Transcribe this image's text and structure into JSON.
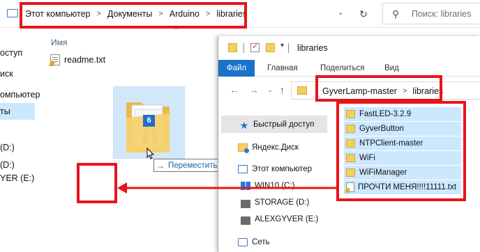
{
  "back_window": {
    "breadcrumbs": [
      "Этот компьютер",
      "Документы",
      "Arduino",
      "libraries"
    ],
    "search_placeholder": "Поиск: libraries",
    "sidebar_items": [
      "оступ",
      "иск",
      "омпьютер",
      "ты",
      "(D:)",
      "(D:)",
      "YER (E:)"
    ],
    "column_header": "Имя",
    "files": [
      {
        "name": "readme.txt",
        "icon": "text-file-icon"
      }
    ],
    "drag_badge_count": "6",
    "drag_tooltip": "Переместить в \"libraries\""
  },
  "front_window": {
    "title": "libraries",
    "ribbon_tabs": [
      "Файл",
      "Главная",
      "Поделиться",
      "Вид"
    ],
    "breadcrumbs": [
      "GyverLamp-master",
      "libraries"
    ],
    "nav_tree": [
      {
        "label": "Быстрый доступ",
        "icon": "star-icon",
        "selected": true
      },
      {
        "label": "Яндекс.Диск",
        "icon": "yandex-disk-icon",
        "selected": false
      },
      {
        "label": "Этот компьютер",
        "icon": "computer-icon",
        "selected": false
      },
      {
        "label": "WIN10 (C:)",
        "icon": "windows-drive-icon",
        "selected": false
      },
      {
        "label": "STORAGE (D:)",
        "icon": "drive-icon",
        "selected": false
      },
      {
        "label": "ALEXGYVER (E:)",
        "icon": "drive-icon",
        "selected": false
      },
      {
        "label": "Сеть",
        "icon": "network-icon",
        "selected": false
      }
    ],
    "files": [
      {
        "name": "FastLED-3.2.9",
        "icon": "folder-icon",
        "selected": true
      },
      {
        "name": "GyverButton",
        "icon": "folder-icon",
        "selected": true
      },
      {
        "name": "NTPClient-master",
        "icon": "folder-icon",
        "selected": true
      },
      {
        "name": "WiFi",
        "icon": "folder-icon",
        "selected": true
      },
      {
        "name": "WiFiManager",
        "icon": "folder-icon",
        "selected": true
      },
      {
        "name": "ПРОЧТИ МЕНЯ!!!!11111.txt",
        "icon": "text-file-icon",
        "selected": true
      }
    ]
  },
  "colors": {
    "annotation_red": "#e8141c",
    "selection_blue": "#cce8ff",
    "ribbon_file_blue": "#1a73c9"
  }
}
